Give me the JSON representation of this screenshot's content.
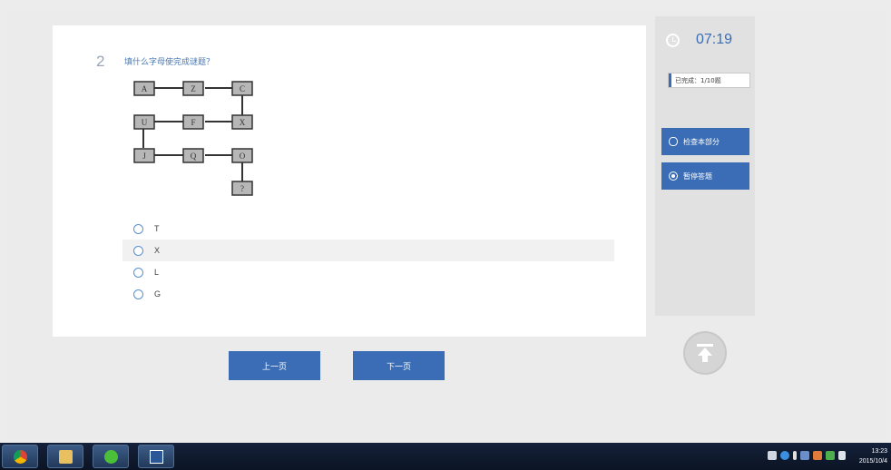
{
  "question": {
    "number": "2",
    "prompt": "填什么字母使完成谜题？"
  },
  "puzzle": {
    "cells": [
      "A",
      "Z",
      "C",
      "U",
      "F",
      "X",
      "J",
      "Q",
      "O",
      "?"
    ]
  },
  "choices": [
    {
      "label": "T"
    },
    {
      "label": "X"
    },
    {
      "label": "L"
    },
    {
      "label": "G"
    }
  ],
  "navigation": {
    "prev_label": "上一页",
    "next_label": "下一页"
  },
  "sidebar": {
    "timer": "07:19",
    "progress": "已完成：1/10题",
    "check_label": "检查本部分",
    "pause_label": "暂停答题"
  },
  "taskbar": {
    "apps": [
      "chrome-icon",
      "folder-icon",
      "wechat-icon",
      "word-icon"
    ],
    "time": "13:23",
    "date": "2015/10/4"
  },
  "colors": {
    "accent": "#3a6db5",
    "page_bg": "#ebebeb",
    "card_bg": "#ffffff"
  }
}
